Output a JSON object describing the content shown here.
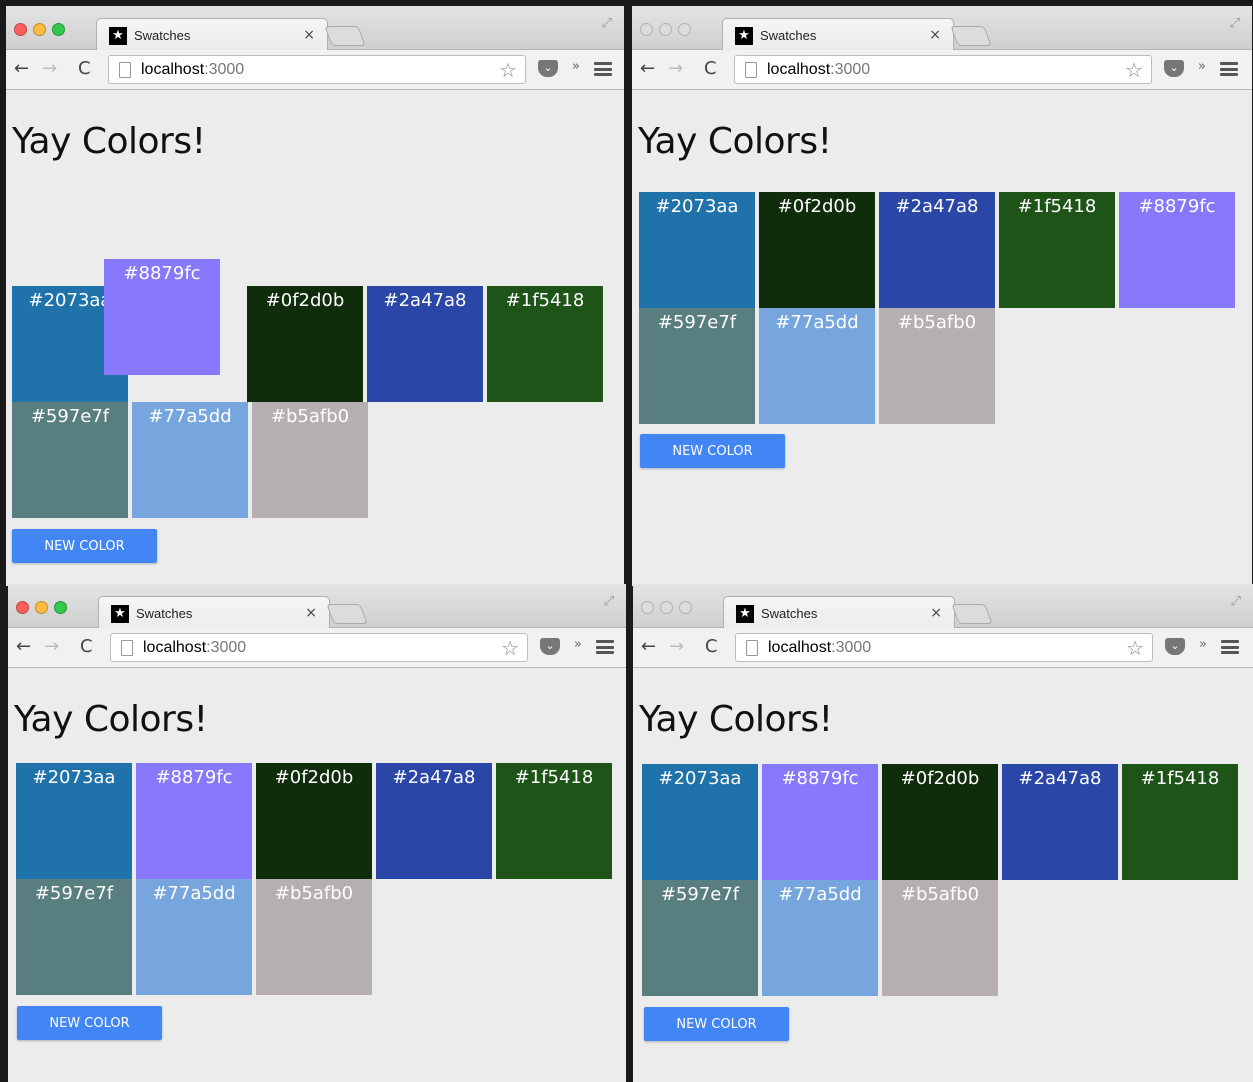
{
  "tab": {
    "title": "Swatches",
    "close": "×"
  },
  "address": {
    "host": "localhost",
    "port": ":3000"
  },
  "page": {
    "heading": "Yay Colors!",
    "button": "NEW COLOR"
  },
  "icons": {
    "back": "←",
    "forward": "→",
    "reload": "C",
    "star": "☆",
    "overflow": "»",
    "fullscreen": "⤢",
    "favicon": "★"
  },
  "windows": [
    {
      "id": "top-left",
      "active": true,
      "dragged_swatch": "#8879fc"
    },
    {
      "id": "top-right",
      "active": false
    },
    {
      "id": "bottom-left",
      "active": true
    },
    {
      "id": "bottom-right",
      "active": false
    }
  ],
  "swatches_in_order": [
    "#2073aa",
    "#8879fc",
    "#0f2d0b",
    "#2a47a8",
    "#1f5418",
    "#597e7f",
    "#77a5dd",
    "#b5afb0"
  ]
}
